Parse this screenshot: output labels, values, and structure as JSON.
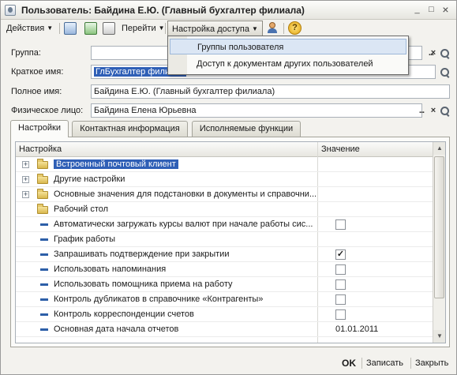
{
  "window": {
    "title": "Пользователь: Байдина Е.Ю. (Главный бухгалтер филиала)",
    "controls": {
      "minimize": "_",
      "maximize": "□",
      "close": "×"
    }
  },
  "toolbar": {
    "actions_label": "Действия",
    "goto_label": "Перейти",
    "access_label": "Настройка доступа",
    "help_icon": "help-icon",
    "user_icon": "user-icon"
  },
  "access_menu": {
    "items": [
      {
        "label": "Группы пользователя"
      },
      {
        "label": "Доступ к документам других пользователей"
      }
    ]
  },
  "form": {
    "group_label": "Группа:",
    "group_value": "",
    "short_name_label": "Краткое имя:",
    "short_name_value": "ГлБухгалтер филиала",
    "full_name_label": "Полное имя:",
    "full_name_value": "Байдина Е.Ю. (Главный бухгалтер филиала)",
    "person_label": "Физическое лицо:",
    "person_value": "Байдина Елена Юрьевна",
    "select_button": "...",
    "clear_button": "×"
  },
  "tabs": [
    {
      "label": "Настройки",
      "active": true
    },
    {
      "label": "Контактная информация",
      "active": false
    },
    {
      "label": "Исполняемые функции",
      "active": false
    }
  ],
  "settings_table": {
    "columns": [
      "Настройка",
      "Значение"
    ],
    "rows": [
      {
        "kind": "group",
        "name": "Встроенный почтовый клиент",
        "value": "",
        "expandable": true,
        "selected": true
      },
      {
        "kind": "group",
        "name": "Другие настройки",
        "value": "",
        "expandable": true
      },
      {
        "kind": "group",
        "name": "Основные значения для подстановки в документы и справочни...",
        "value": "",
        "expandable": true
      },
      {
        "kind": "group",
        "name": "Рабочий стол",
        "value": "",
        "expandable": false
      },
      {
        "kind": "item",
        "name": "Автоматически загружать курсы валют при начале работы сис...",
        "checkbox": true,
        "checked": false
      },
      {
        "kind": "item",
        "name": "График работы",
        "value": ""
      },
      {
        "kind": "item",
        "name": "Запрашивать подтверждение при закрытии",
        "checkbox": true,
        "checked": true
      },
      {
        "kind": "item",
        "name": "Использовать напоминания",
        "checkbox": true,
        "checked": false
      },
      {
        "kind": "item",
        "name": "Использовать помощника приема на работу",
        "checkbox": true,
        "checked": false
      },
      {
        "kind": "item",
        "name": "Контроль дубликатов в справочнике «Контрагенты»",
        "checkbox": true,
        "checked": false
      },
      {
        "kind": "item",
        "name": "Контроль корреспонденции счетов",
        "checkbox": true,
        "checked": false
      },
      {
        "kind": "item",
        "name": "Основная дата начала отчетов",
        "value": "01.01.2011"
      }
    ]
  },
  "footer": {
    "ok_label": "OK",
    "save_label": "Записать",
    "close_label": "Закрыть"
  },
  "colors": {
    "selection": "#2f5fb6",
    "menu_highlight": "#dbe6f4",
    "window_bg": "#f3f2ee"
  }
}
